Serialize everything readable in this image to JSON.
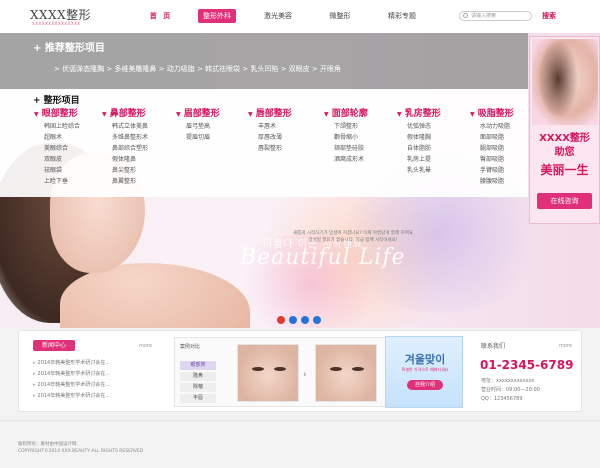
{
  "header": {
    "logo": "XXXX整形",
    "logo_sub": "XXXXXXXXXXXXXXX",
    "nav": [
      "首 页",
      "整形外科",
      "激光美容",
      "微整形",
      "精彩专题"
    ],
    "search_placeholder": "请输入搜索",
    "search_button": "搜索"
  },
  "promo": {
    "title": "+ 推荐整形项目",
    "links": "> 优弧弹态隆胸 > 多维美雕隆鼻 > 动力吸脂 > 韩式祛眼袋 > 乳头凹陷 > 双眼皮 > 开眼角"
  },
  "menu": {
    "title": "+ 整形项目",
    "columns": [
      {
        "title": "眼部整形",
        "items": [
          "韩国上睑综合",
          "超眼术",
          "美眼综合",
          "双眼皮",
          "祛眼袋",
          "上睑下垂"
        ]
      },
      {
        "title": "鼻部整形",
        "items": [
          "韩式立体美鼻",
          "多维鼻整形术",
          "鼻部综合塑形",
          "假体隆鼻",
          "鼻尖整形",
          "鼻翼整形"
        ]
      },
      {
        "title": "眉部整形",
        "items": [
          "眉弓垫高",
          "提眉切眉"
        ]
      },
      {
        "title": "唇部整形",
        "items": [
          "丰唇术",
          "厚唇改薄",
          "唇裂整形"
        ]
      },
      {
        "title": "面部轮廓",
        "items": [
          "下颌整形",
          "颧骨缩小",
          "颏部垫硅胶",
          "酒窝成形术"
        ]
      },
      {
        "title": "乳房整形",
        "items": [
          "优弧弹态",
          "假体隆胸",
          "自体脂肪",
          "乳房上提",
          "乳头乳晕"
        ]
      },
      {
        "title": "吸脂整形",
        "items": [
          "水动力吸脂",
          "面部吸脂",
          "腿部吸脂",
          "臀部吸脂",
          "手臂吸脂",
          "腰腹吸脂"
        ]
      }
    ]
  },
  "banner": {
    "korean_title": "이쁠다 이쁜 시작해요",
    "script": "Beautiful Life",
    "small_lines": [
      "새롭게 시작하기가 망설여 지셨나요? 이제 아름답게 함께 하여요",
      "망설일 필요가 없습니다. 지금 함께 시작하세요!"
    ]
  },
  "side_ad": {
    "line1": "XXXX整形",
    "line2": "助您",
    "line3": "美丽一生",
    "button": "在线咨询"
  },
  "bottom": {
    "news_tab": "新闻中心",
    "more": "more",
    "news": [
      "2014年韩美整形学术研讨会在...",
      "2014年韩美整形学术研讨会在...",
      "2014年韩美整形学术研讨会在...",
      "2014年韩美整形学术研讨会在..."
    ],
    "case_title": "案例对比",
    "case_categories": [
      "眼部类",
      "隆鼻",
      "除皱",
      "丰唇"
    ],
    "promo_card": {
      "title": "겨울맞이",
      "sub": "특별한 가격으로 예뻐지세요",
      "button": "自我介绍"
    },
    "contact_title": "联系我们",
    "contact_more": "more",
    "phone": "01-2345-6789",
    "contact_lines": [
      "地址：xxxxxxxxxxxxx",
      "营业时间：09:00—20:00",
      "QQ：123456789"
    ]
  },
  "footer": {
    "line1": "版权所有：素材由中国设计网",
    "line2": "COPYRIGHT©2014 XXX.BEAUTY ALL RIGHTS RESERVED"
  },
  "colors": {
    "accent": "#e0307a",
    "accent_dark": "#d6155f",
    "dot_blue": "#2575d6",
    "dot_red": "#e43a2e"
  }
}
